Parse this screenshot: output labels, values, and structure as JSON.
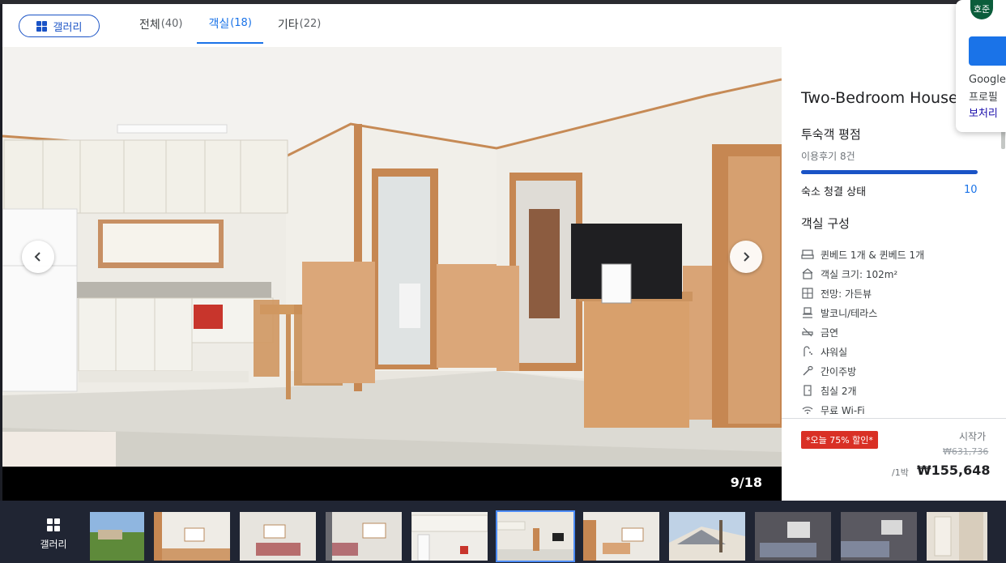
{
  "header": {
    "gallery_label": "갤러리",
    "tabs": [
      {
        "label": "전체",
        "count": "(40)"
      },
      {
        "label": "객실",
        "count": "(18)"
      },
      {
        "label": "기타",
        "count": "(22)"
      }
    ]
  },
  "viewer": {
    "counter": "9/18"
  },
  "side": {
    "title": "Two-Bedroom House",
    "rating_heading": "투숙객 평점",
    "reviews": "이용후기 8건",
    "clean_label": "숙소 청결 상태",
    "clean_value": "10",
    "clean_fraction": 1.0,
    "rooms_heading": "객실 구성",
    "amenities": [
      {
        "icon": "bed-icon",
        "label": "퀸베드 1개 & 퀸베드 1개"
      },
      {
        "icon": "house-icon",
        "label": "객실 크기: 102m²"
      },
      {
        "icon": "view-icon",
        "label": "전망: 가든뷰"
      },
      {
        "icon": "balcony-icon",
        "label": "발코니/테라스"
      },
      {
        "icon": "no-smoking-icon",
        "label": "금연"
      },
      {
        "icon": "shower-icon",
        "label": "샤워실"
      },
      {
        "icon": "kitchen-icon",
        "label": "간이주방"
      },
      {
        "icon": "door-icon",
        "label": "침실 2개"
      },
      {
        "icon": "wifi-icon",
        "label": "무료 Wi-Fi"
      }
    ],
    "promo": "*오늘 75% 할인*",
    "from_label": "시작가",
    "old_price": "₩631,736",
    "per_night": "/1박",
    "price": "₩155,648"
  },
  "google_card": {
    "avatar": "호준",
    "line1": "Google",
    "line2": "프로필",
    "line3": "보처리"
  },
  "filmstrip": {
    "gallery_label": "갤러리",
    "active_index": 5
  }
}
